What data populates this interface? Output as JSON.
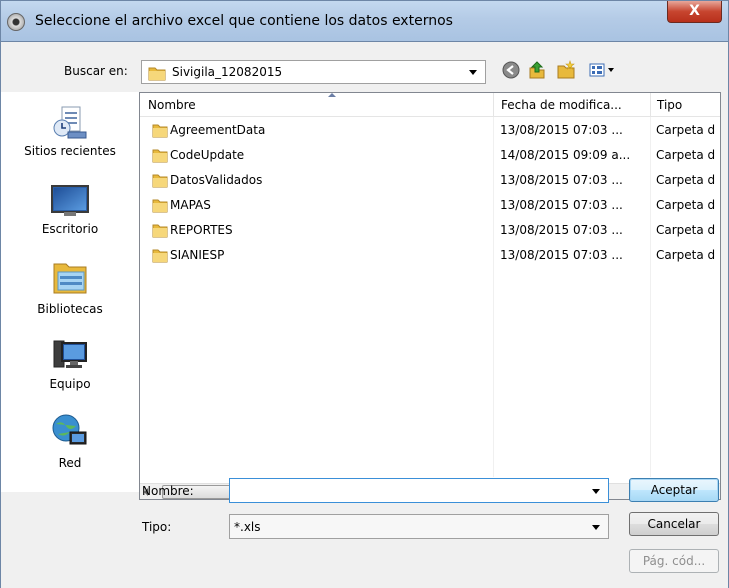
{
  "window": {
    "title": "Seleccione el archivo excel que contiene los datos externos",
    "close_label": "X"
  },
  "lookin": {
    "label": "Buscar en:",
    "value": "Sivigila_12082015"
  },
  "toolbar": {
    "back_icon": "back-arrow-icon",
    "up_icon": "up-folder-icon",
    "newfolder_icon": "new-folder-icon",
    "view_icon": "view-menu-icon"
  },
  "places": [
    {
      "label": "Sitios recientes",
      "icon": "recent-places-icon"
    },
    {
      "label": "Escritorio",
      "icon": "desktop-icon"
    },
    {
      "label": "Bibliotecas",
      "icon": "libraries-icon"
    },
    {
      "label": "Equipo",
      "icon": "computer-icon"
    },
    {
      "label": "Red",
      "icon": "network-icon"
    }
  ],
  "columns": {
    "name": "Nombre",
    "date": "Fecha de modifica...",
    "type": "Tipo"
  },
  "files": [
    {
      "name": "AgreementData",
      "date": "13/08/2015 07:03 ...",
      "type": "Carpeta d"
    },
    {
      "name": "CodeUpdate",
      "date": "14/08/2015 09:09 a...",
      "type": "Carpeta d"
    },
    {
      "name": "DatosValidados",
      "date": "13/08/2015 07:03 ...",
      "type": "Carpeta d"
    },
    {
      "name": "MAPAS",
      "date": "13/08/2015 07:03 ...",
      "type": "Carpeta d"
    },
    {
      "name": "REPORTES",
      "date": "13/08/2015 07:03 ...",
      "type": "Carpeta d"
    },
    {
      "name": "SIANIESP",
      "date": "13/08/2015 07:03 ...",
      "type": "Carpeta d"
    }
  ],
  "scroll_grip": "III",
  "filename": {
    "label": "Nombre:",
    "value": ""
  },
  "filetype": {
    "label": "Tipo:",
    "value": "*.xls"
  },
  "buttons": {
    "ok": "Aceptar",
    "cancel": "Cancelar",
    "code": "Pág. cód..."
  },
  "colors": {
    "titlebar": "#b4cbe6",
    "folder": "#e8b93c",
    "close": "#c7452f"
  }
}
